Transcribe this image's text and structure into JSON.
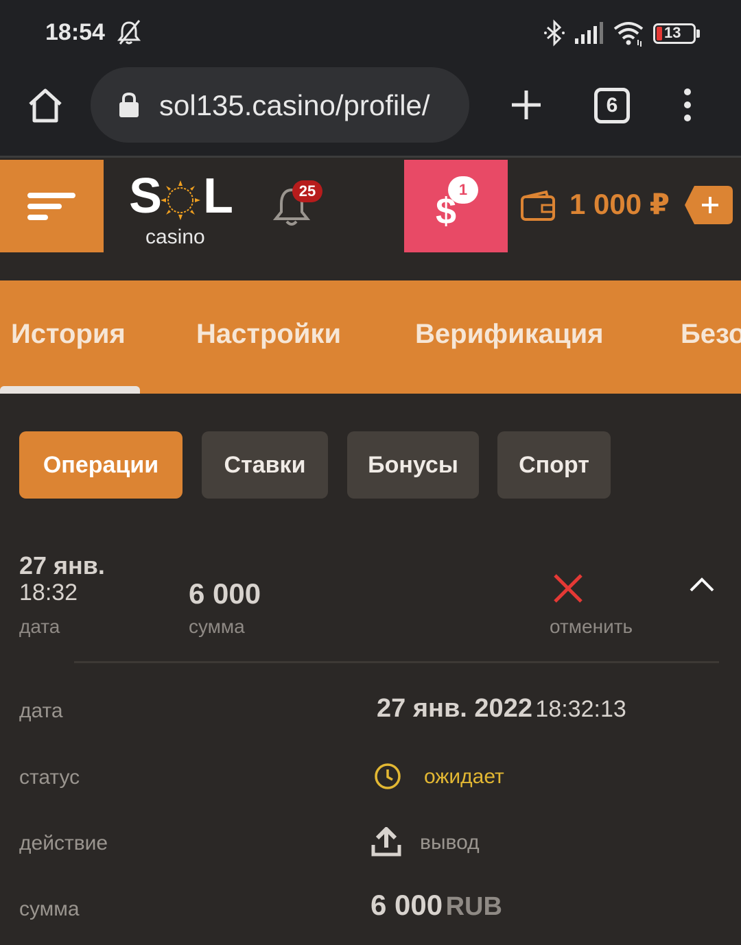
{
  "status_bar": {
    "time": "18:54",
    "battery": "13"
  },
  "browser": {
    "url": "sol135.casino/profile/",
    "tab_count": "6"
  },
  "header": {
    "logo_text": "SOL",
    "logo_sub": "casino",
    "notifications_count": "25",
    "cashback_count": "1",
    "balance": "1 000 ₽"
  },
  "profile_tabs": [
    "История",
    "Настройки",
    "Верификация",
    "Безопасность"
  ],
  "history_chips": [
    "Операции",
    "Ставки",
    "Бонусы",
    "Спорт"
  ],
  "operation": {
    "date": "27 янв.",
    "time": "18:32",
    "date_label": "дата",
    "amount": "6 000",
    "amount_label": "сумма",
    "cancel_label": "отменить"
  },
  "details": {
    "date_label": "дата",
    "date_value": "27 янв. 2022",
    "time_value": "18:32:13",
    "status_label": "статус",
    "status_value": "ожидает",
    "action_label": "действие",
    "action_value": "вывод",
    "sum_label": "сумма",
    "sum_value": "6 000",
    "sum_currency": "RUB"
  },
  "colors": {
    "accent": "#dc8433",
    "cashback": "#e84a66",
    "pending": "#e3b833",
    "cancel": "#e53935"
  }
}
